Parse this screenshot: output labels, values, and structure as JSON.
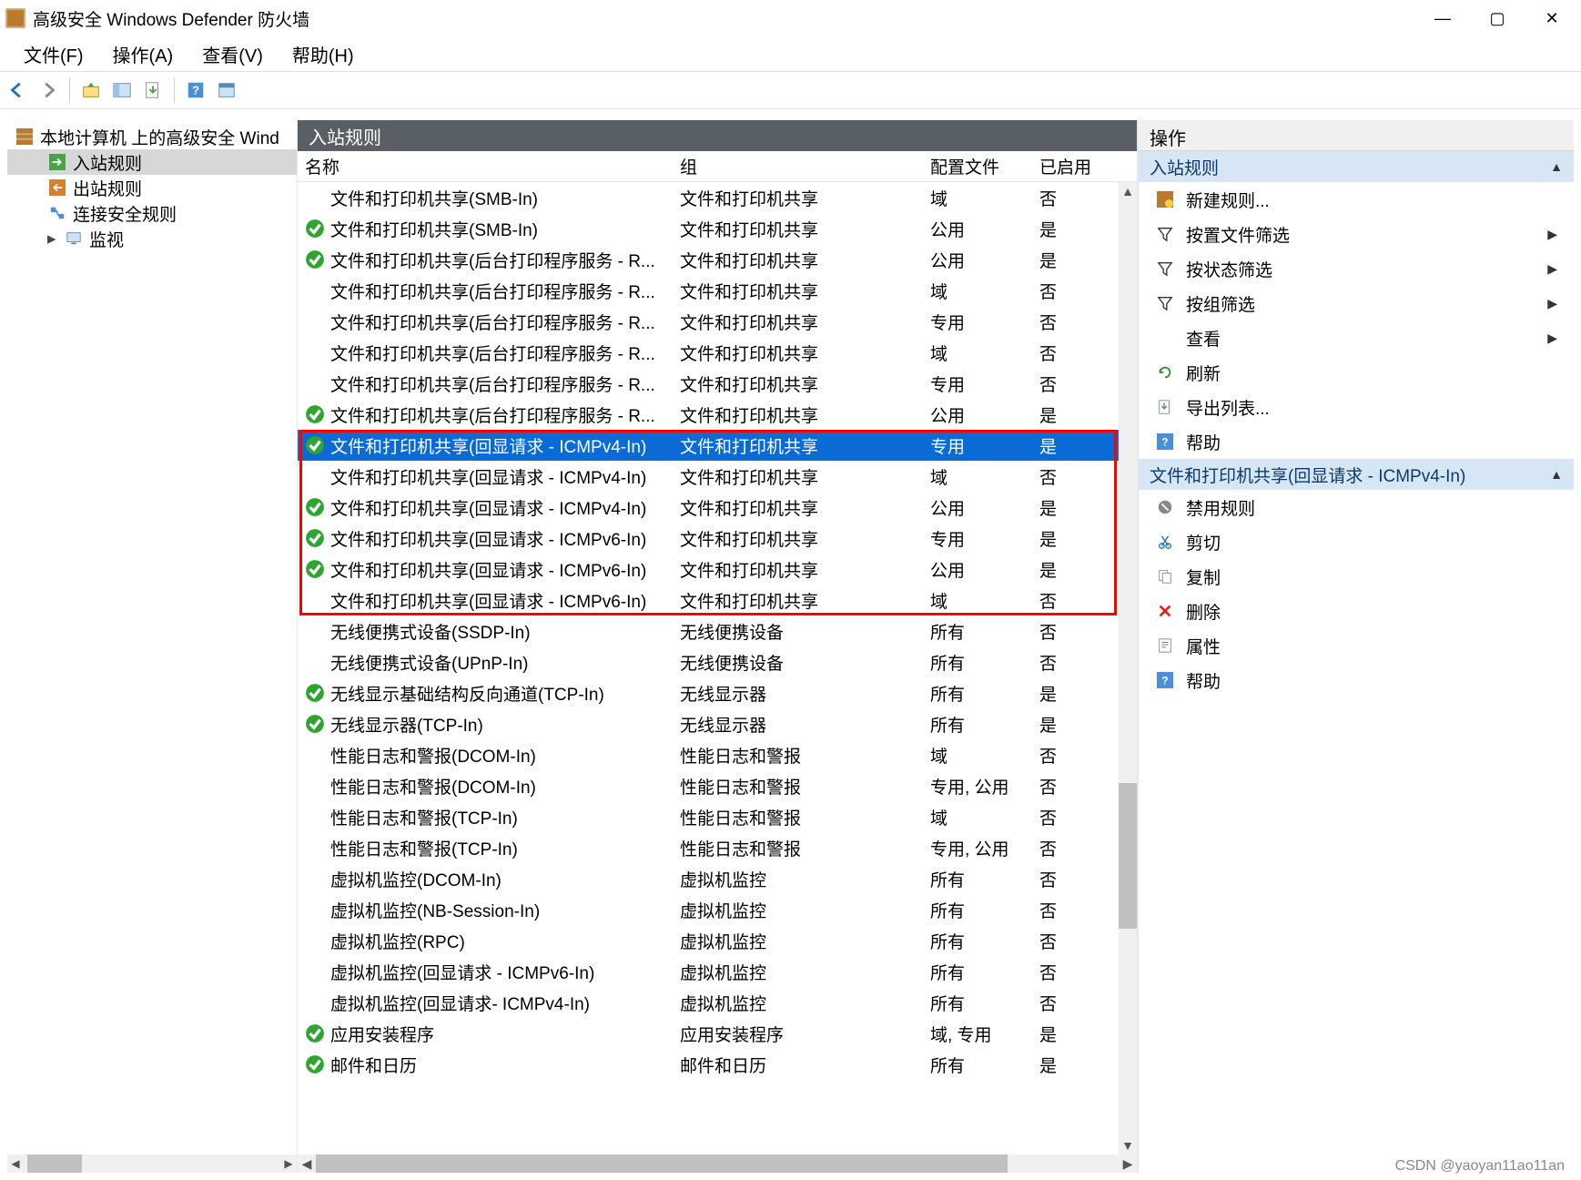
{
  "title_bar": {
    "title": "高级安全 Windows Defender 防火墙"
  },
  "menu": {
    "file": "文件(F)",
    "action": "操作(A)",
    "view": "查看(V)",
    "help": "帮助(H)"
  },
  "tree": {
    "root": "本地计算机 上的高级安全 Wind",
    "inbound": "入站规则",
    "outbound": "出站规则",
    "connsec": "连接安全规则",
    "monitor": "监视"
  },
  "center": {
    "header": "入站规则",
    "columns": {
      "name": "名称",
      "group": "组",
      "profile": "配置文件",
      "enabled": "已启用"
    },
    "rows": [
      {
        "enabled": false,
        "name": "文件和打印机共享(SMB-In)",
        "group": "文件和打印机共享",
        "profile": "域",
        "enable_label": "否"
      },
      {
        "enabled": true,
        "name": "文件和打印机共享(SMB-In)",
        "group": "文件和打印机共享",
        "profile": "公用",
        "enable_label": "是"
      },
      {
        "enabled": true,
        "name": "文件和打印机共享(后台打印程序服务 - R...",
        "group": "文件和打印机共享",
        "profile": "公用",
        "enable_label": "是"
      },
      {
        "enabled": false,
        "name": "文件和打印机共享(后台打印程序服务 - R...",
        "group": "文件和打印机共享",
        "profile": "域",
        "enable_label": "否"
      },
      {
        "enabled": false,
        "name": "文件和打印机共享(后台打印程序服务 - R...",
        "group": "文件和打印机共享",
        "profile": "专用",
        "enable_label": "否"
      },
      {
        "enabled": false,
        "name": "文件和打印机共享(后台打印程序服务 - R...",
        "group": "文件和打印机共享",
        "profile": "域",
        "enable_label": "否"
      },
      {
        "enabled": false,
        "name": "文件和打印机共享(后台打印程序服务 - R...",
        "group": "文件和打印机共享",
        "profile": "专用",
        "enable_label": "否"
      },
      {
        "enabled": true,
        "name": "文件和打印机共享(后台打印程序服务 - R...",
        "group": "文件和打印机共享",
        "profile": "公用",
        "enable_label": "是"
      },
      {
        "enabled": true,
        "name": "文件和打印机共享(回显请求 - ICMPv4-In)",
        "group": "文件和打印机共享",
        "profile": "专用",
        "enable_label": "是",
        "selected": true
      },
      {
        "enabled": false,
        "name": "文件和打印机共享(回显请求 - ICMPv4-In)",
        "group": "文件和打印机共享",
        "profile": "域",
        "enable_label": "否"
      },
      {
        "enabled": true,
        "name": "文件和打印机共享(回显请求 - ICMPv4-In)",
        "group": "文件和打印机共享",
        "profile": "公用",
        "enable_label": "是"
      },
      {
        "enabled": true,
        "name": "文件和打印机共享(回显请求 - ICMPv6-In)",
        "group": "文件和打印机共享",
        "profile": "专用",
        "enable_label": "是"
      },
      {
        "enabled": true,
        "name": "文件和打印机共享(回显请求 - ICMPv6-In)",
        "group": "文件和打印机共享",
        "profile": "公用",
        "enable_label": "是"
      },
      {
        "enabled": false,
        "name": "文件和打印机共享(回显请求 - ICMPv6-In)",
        "group": "文件和打印机共享",
        "profile": "域",
        "enable_label": "否"
      },
      {
        "enabled": false,
        "name": "无线便携式设备(SSDP-In)",
        "group": "无线便携设备",
        "profile": "所有",
        "enable_label": "否"
      },
      {
        "enabled": false,
        "name": "无线便携式设备(UPnP-In)",
        "group": "无线便携设备",
        "profile": "所有",
        "enable_label": "否"
      },
      {
        "enabled": true,
        "name": "无线显示基础结构反向通道(TCP-In)",
        "group": "无线显示器",
        "profile": "所有",
        "enable_label": "是"
      },
      {
        "enabled": true,
        "name": "无线显示器(TCP-In)",
        "group": "无线显示器",
        "profile": "所有",
        "enable_label": "是"
      },
      {
        "enabled": false,
        "name": "性能日志和警报(DCOM-In)",
        "group": "性能日志和警报",
        "profile": "域",
        "enable_label": "否"
      },
      {
        "enabled": false,
        "name": "性能日志和警报(DCOM-In)",
        "group": "性能日志和警报",
        "profile": "专用, 公用",
        "enable_label": "否"
      },
      {
        "enabled": false,
        "name": "性能日志和警报(TCP-In)",
        "group": "性能日志和警报",
        "profile": "域",
        "enable_label": "否"
      },
      {
        "enabled": false,
        "name": "性能日志和警报(TCP-In)",
        "group": "性能日志和警报",
        "profile": "专用, 公用",
        "enable_label": "否"
      },
      {
        "enabled": false,
        "name": "虚拟机监控(DCOM-In)",
        "group": "虚拟机监控",
        "profile": "所有",
        "enable_label": "否"
      },
      {
        "enabled": false,
        "name": "虚拟机监控(NB-Session-In)",
        "group": "虚拟机监控",
        "profile": "所有",
        "enable_label": "否"
      },
      {
        "enabled": false,
        "name": "虚拟机监控(RPC)",
        "group": "虚拟机监控",
        "profile": "所有",
        "enable_label": "否"
      },
      {
        "enabled": false,
        "name": "虚拟机监控(回显请求 - ICMPv6-In)",
        "group": "虚拟机监控",
        "profile": "所有",
        "enable_label": "否"
      },
      {
        "enabled": false,
        "name": "虚拟机监控(回显请求- ICMPv4-In)",
        "group": "虚拟机监控",
        "profile": "所有",
        "enable_label": "否"
      },
      {
        "enabled": true,
        "name": "应用安装程序",
        "group": "应用安装程序",
        "profile": "域, 专用",
        "enable_label": "是"
      },
      {
        "enabled": true,
        "name": "邮件和日历",
        "group": "邮件和日历",
        "profile": "所有",
        "enable_label": "是"
      }
    ],
    "highlight_start_row_index": 8,
    "highlight_end_row_index": 13
  },
  "actions": {
    "header": "操作",
    "section1_title": "入站规则",
    "new_rule": "新建规则...",
    "filter_profile": "按置文件筛选",
    "filter_state": "按状态筛选",
    "filter_group": "按组筛选",
    "view": "查看",
    "refresh": "刷新",
    "export": "导出列表...",
    "help": "帮助",
    "section2_title": "文件和打印机共享(回显请求 - ICMPv4-In)",
    "disable": "禁用规则",
    "cut": "剪切",
    "copy": "复制",
    "delete": "删除",
    "properties": "属性",
    "help2": "帮助"
  },
  "watermark": "CSDN @yaoyan11ao11an"
}
